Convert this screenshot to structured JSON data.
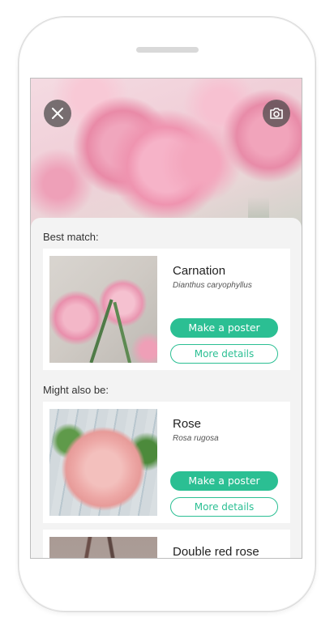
{
  "hero": {
    "close_icon": "close-icon",
    "camera_icon": "camera-icon"
  },
  "best_match": {
    "label": "Best match:",
    "name": "Carnation",
    "latin": "Dianthus caryophyllus",
    "poster_label": "Make a poster",
    "details_label": "More details"
  },
  "alternatives": {
    "label": "Might also be:",
    "items": [
      {
        "name": "Rose",
        "latin": "Rosa rugosa",
        "poster_label": "Make a poster",
        "details_label": "More details"
      },
      {
        "name": "Double red rose"
      }
    ]
  },
  "colors": {
    "accent": "#2bbf93",
    "background": "#f3f3f3"
  }
}
